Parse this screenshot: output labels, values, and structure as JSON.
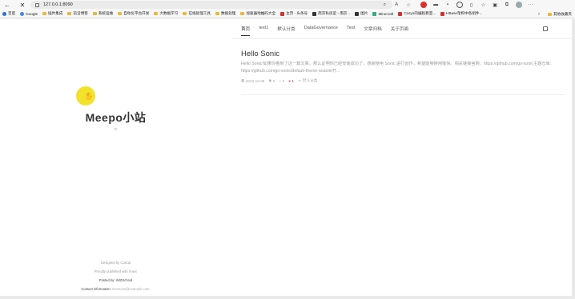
{
  "browser": {
    "address": "127.0.0.1:8090",
    "nav": {
      "back_icon": "←",
      "reload_icon": "✕"
    },
    "bookmarks": [
      {
        "label": "百度",
        "icon": "baidu"
      },
      {
        "label": "Google",
        "icon": "google"
      },
      {
        "label": "插件集成",
        "icon": "folder"
      },
      {
        "label": "前沿博客",
        "icon": "folder"
      },
      {
        "label": "系统运维",
        "icon": "folder"
      },
      {
        "label": "自动化平台开发",
        "icon": "folder"
      },
      {
        "label": "大数据学习",
        "icon": "folder"
      },
      {
        "label": "在线处理工具",
        "icon": "folder"
      },
      {
        "label": "数据处理",
        "icon": "folder"
      },
      {
        "label": "加速器地推码大全",
        "icon": "folder"
      },
      {
        "label": "主页 - 头条号",
        "icon": "toutiao"
      },
      {
        "label": "南京私房菜 - 南京...",
        "icon": "site"
      },
      {
        "label": "图片",
        "icon": "image"
      },
      {
        "label": "Minecraft",
        "icon": "minecraft"
      },
      {
        "label": "Cosyo的编程教室...",
        "icon": "site"
      },
      {
        "label": "HBase架构中各组件...",
        "icon": "site"
      }
    ],
    "bookmarks_more": "›",
    "other_bookmarks": "其他收藏夹"
  },
  "sidebar": {
    "logo_glyph": "✋",
    "site_title": "Meepo小站",
    "rss_icon": "⊃",
    "footer": {
      "designed_by": "Designed by CaiCai",
      "published_with": "Proudly published with Sonic",
      "posted_by": "Posted by: WIZSchool",
      "contact_label": "Contact information:",
      "contact_email": "someone@example.com."
    }
  },
  "nav": {
    "items": [
      "首页",
      "test1",
      "默认分类",
      "DataGovernance",
      "Test",
      "文章归档",
      "关于页面"
    ],
    "active_index": 0
  },
  "post": {
    "title": "Hello Sonic",
    "excerpt": "Hello Sonic!如果你看到了这一篇文章，那么证明你已经安装成功了，感谢使用 Sonic 进行创作，希望能够使用愉快。相关链接官网：https://github.com/go-sonic主题仓库：https://github.com/go-sonic/default-theme-anatole开...",
    "date": "2023-10-09",
    "views": "6",
    "comments": "0",
    "likes": "1",
    "category": "默认分类"
  },
  "colors": {
    "logo": "#f3e22a",
    "heart": "#e0556b",
    "folder": "#e8b93a"
  }
}
